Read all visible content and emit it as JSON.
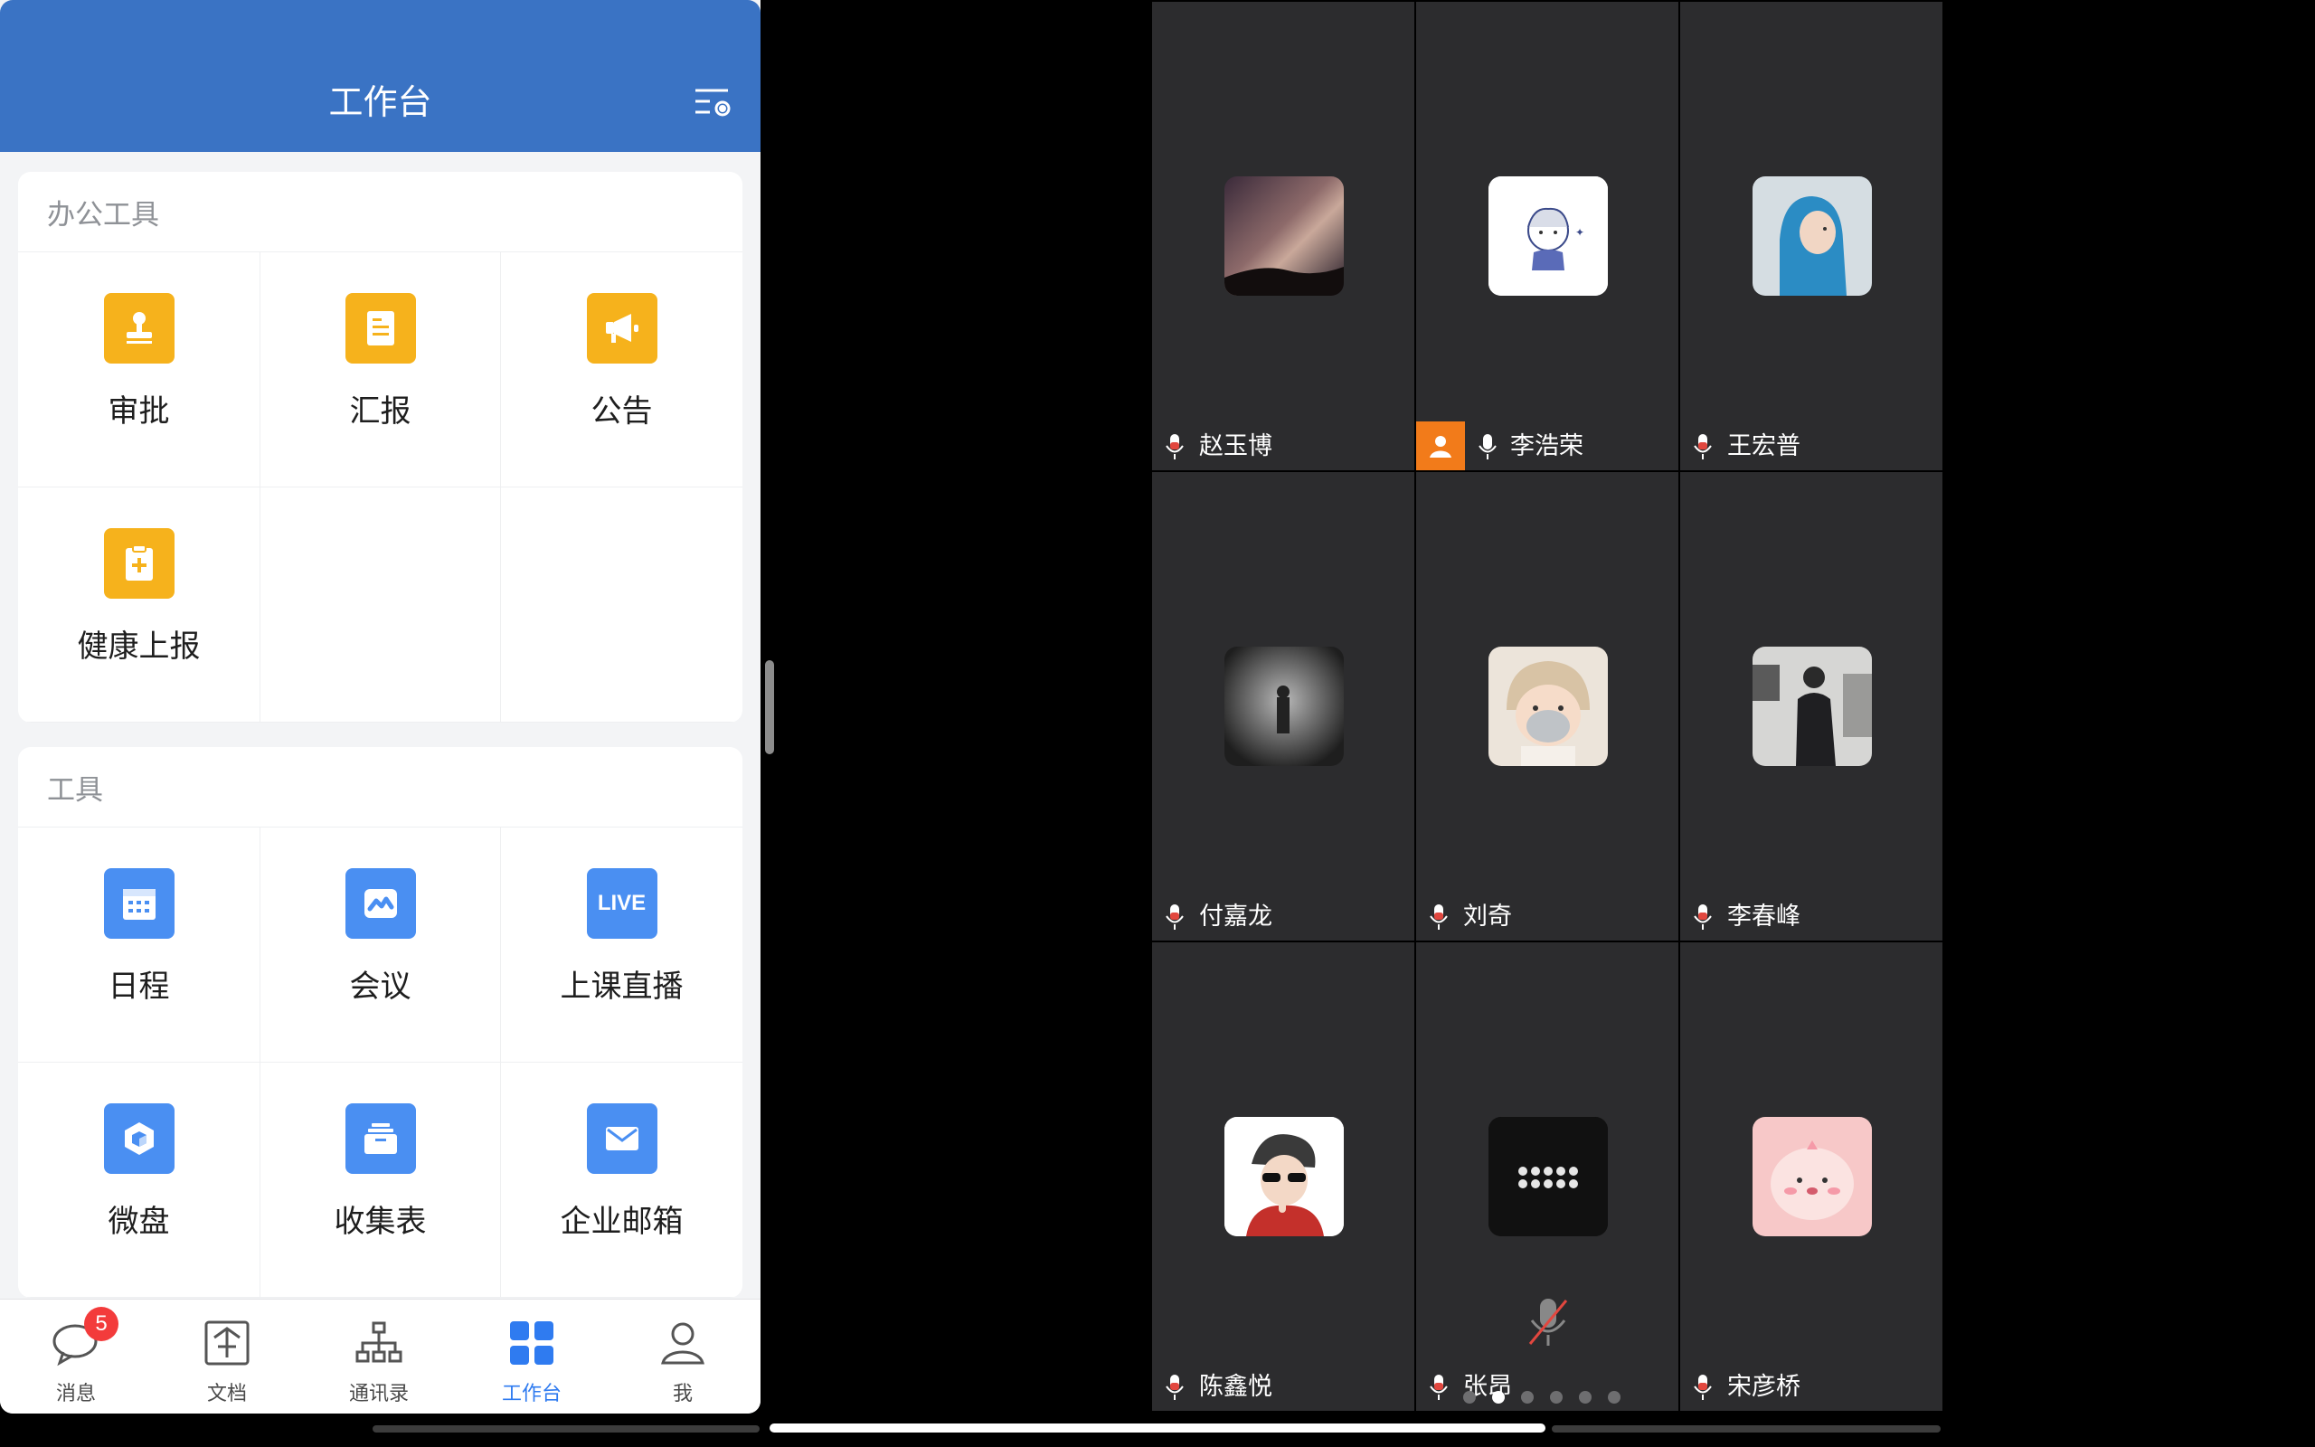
{
  "header": {
    "title": "工作台",
    "settings_icon": "list-settings-icon"
  },
  "office_tools": {
    "title": "办公工具",
    "items": [
      {
        "label": "审批",
        "icon": "stamp-icon",
        "color": "#f6b21c"
      },
      {
        "label": "汇报",
        "icon": "report-document-icon",
        "color": "#f6b21c"
      },
      {
        "label": "公告",
        "icon": "megaphone-icon",
        "color": "#f6b21c"
      },
      {
        "label": "健康上报",
        "icon": "health-clipboard-icon",
        "color": "#f6b21c"
      }
    ]
  },
  "tools": {
    "title": "工具",
    "items": [
      {
        "label": "日程",
        "icon": "calendar-icon",
        "color": "#4a8ff2"
      },
      {
        "label": "会议",
        "icon": "meeting-icon",
        "color": "#4a8ff2"
      },
      {
        "label": "上课直播",
        "icon": "live-icon",
        "icon_text": "LIVE",
        "color": "#4a8ff2"
      },
      {
        "label": "微盘",
        "icon": "drive-cube-icon",
        "color": "#4a8ff2"
      },
      {
        "label": "收集表",
        "icon": "collect-form-icon",
        "color": "#4a8ff2"
      },
      {
        "label": "企业邮箱",
        "icon": "mail-icon",
        "color": "#4a8ff2"
      }
    ]
  },
  "tabbar": {
    "items": [
      {
        "label": "消息",
        "icon": "chat-bubble-icon",
        "badge": "5",
        "active": false
      },
      {
        "label": "文档",
        "icon": "document-icon",
        "active": false
      },
      {
        "label": "通讯录",
        "icon": "org-chart-icon",
        "active": false
      },
      {
        "label": "工作台",
        "icon": "workbench-grid-icon",
        "active": true
      },
      {
        "label": "我",
        "icon": "person-icon",
        "active": false
      }
    ],
    "active_color": "#2f7bf0"
  },
  "meeting": {
    "participants": [
      {
        "name": "赵玉博",
        "avatar": "milky-way-photo"
      },
      {
        "name": "李浩荣",
        "avatar": "cartoon-boy-drawing",
        "host": true
      },
      {
        "name": "王宏普",
        "avatar": "child-blue-hoodie-photo"
      },
      {
        "name": "付嘉龙",
        "avatar": "blurred-street-photo"
      },
      {
        "name": "刘奇",
        "avatar": "baby-mask-photo"
      },
      {
        "name": "李春峰",
        "avatar": "man-indoor-photo"
      },
      {
        "name": "陈鑫悦",
        "avatar": "girl-beret-photo"
      },
      {
        "name": "张昂",
        "avatar": "dark-icons-image",
        "muted": true
      },
      {
        "name": "宋彦桥",
        "avatar": "pink-cartoon-image"
      }
    ],
    "page_count": 6,
    "current_page": 2
  }
}
